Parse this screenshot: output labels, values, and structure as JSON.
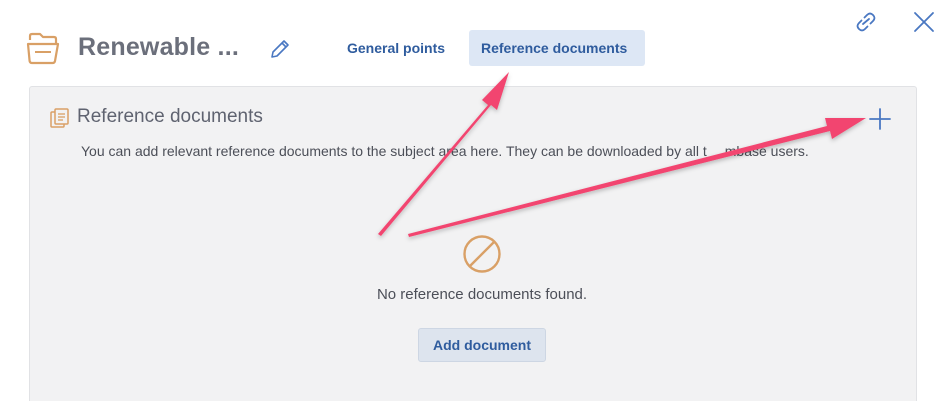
{
  "header": {
    "title": "Renewable ...",
    "folder_icon": "folder-icon",
    "edit_icon": "pencil-icon"
  },
  "tabs": [
    {
      "label": "General points",
      "active": false
    },
    {
      "label": "Reference documents",
      "active": true
    }
  ],
  "window_actions": {
    "link_icon": "link-icon",
    "close_icon": "close-icon"
  },
  "panel": {
    "title": "Reference documents",
    "icon": "documents-icon",
    "add_icon": "plus-icon",
    "description": "You can add relevant reference documents to the subject area here. They can be downloaded by all t",
    "description_tail": "mbase users."
  },
  "empty_state": {
    "icon": "no-entry-icon",
    "message": "No reference documents found.",
    "button_label": "Add document"
  },
  "colors": {
    "accent": "#2f5c9e",
    "active_tab_bg": "#dde7f5",
    "folder_icon": "#d9a066",
    "annotation_arrow": "#f2456f",
    "panel_bg": "#f2f2f3"
  }
}
